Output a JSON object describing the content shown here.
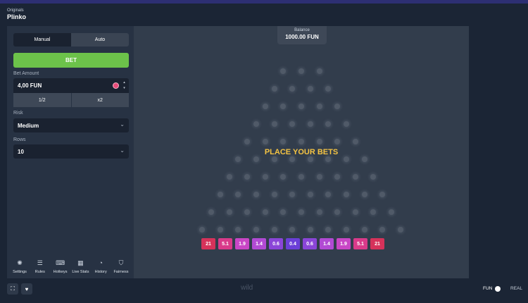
{
  "header": {
    "section": "Originals",
    "game": "Plinko"
  },
  "tabs": [
    "Manual",
    "Auto"
  ],
  "bet_button": "BET",
  "bet_amount": {
    "label": "Bet Amount",
    "value": "4,00 FUN",
    "half": "1/2",
    "double": "x2",
    "up": "▴",
    "down": "▾"
  },
  "risk": {
    "label": "Risk",
    "value": "Medium"
  },
  "rows": {
    "label": "Rows",
    "value": "10"
  },
  "footer_menu": [
    {
      "label": "Settings",
      "icon": "settings-icon"
    },
    {
      "label": "Rules",
      "icon": "rules-icon"
    },
    {
      "label": "Hotkeys",
      "icon": "hotkeys-icon"
    },
    {
      "label": "Live Stats",
      "icon": "live-stats-icon"
    },
    {
      "label": "History",
      "icon": "history-icon"
    },
    {
      "label": "Fairness",
      "icon": "fairness-icon"
    }
  ],
  "balance": {
    "label": "Balance",
    "value": "1000.00 FUN"
  },
  "board_message": "PLACE YOUR BETS",
  "multipliers": [
    {
      "label": "21",
      "color": "#d6325a"
    },
    {
      "label": "5.1",
      "color": "#d93a8a"
    },
    {
      "label": "1.9",
      "color": "#c946c6"
    },
    {
      "label": "1.4",
      "color": "#b14ad4"
    },
    {
      "label": "0.6",
      "color": "#8a45d8"
    },
    {
      "label": "0.4",
      "color": "#6b3fd8"
    },
    {
      "label": "0.6",
      "color": "#8a45d8"
    },
    {
      "label": "1.4",
      "color": "#b14ad4"
    },
    {
      "label": "1.9",
      "color": "#c946c6"
    },
    {
      "label": "5.1",
      "color": "#d93a8a"
    },
    {
      "label": "21",
      "color": "#d6325a"
    }
  ],
  "footer": {
    "logo": "wild",
    "fun": "FUN",
    "real": "REAL"
  }
}
